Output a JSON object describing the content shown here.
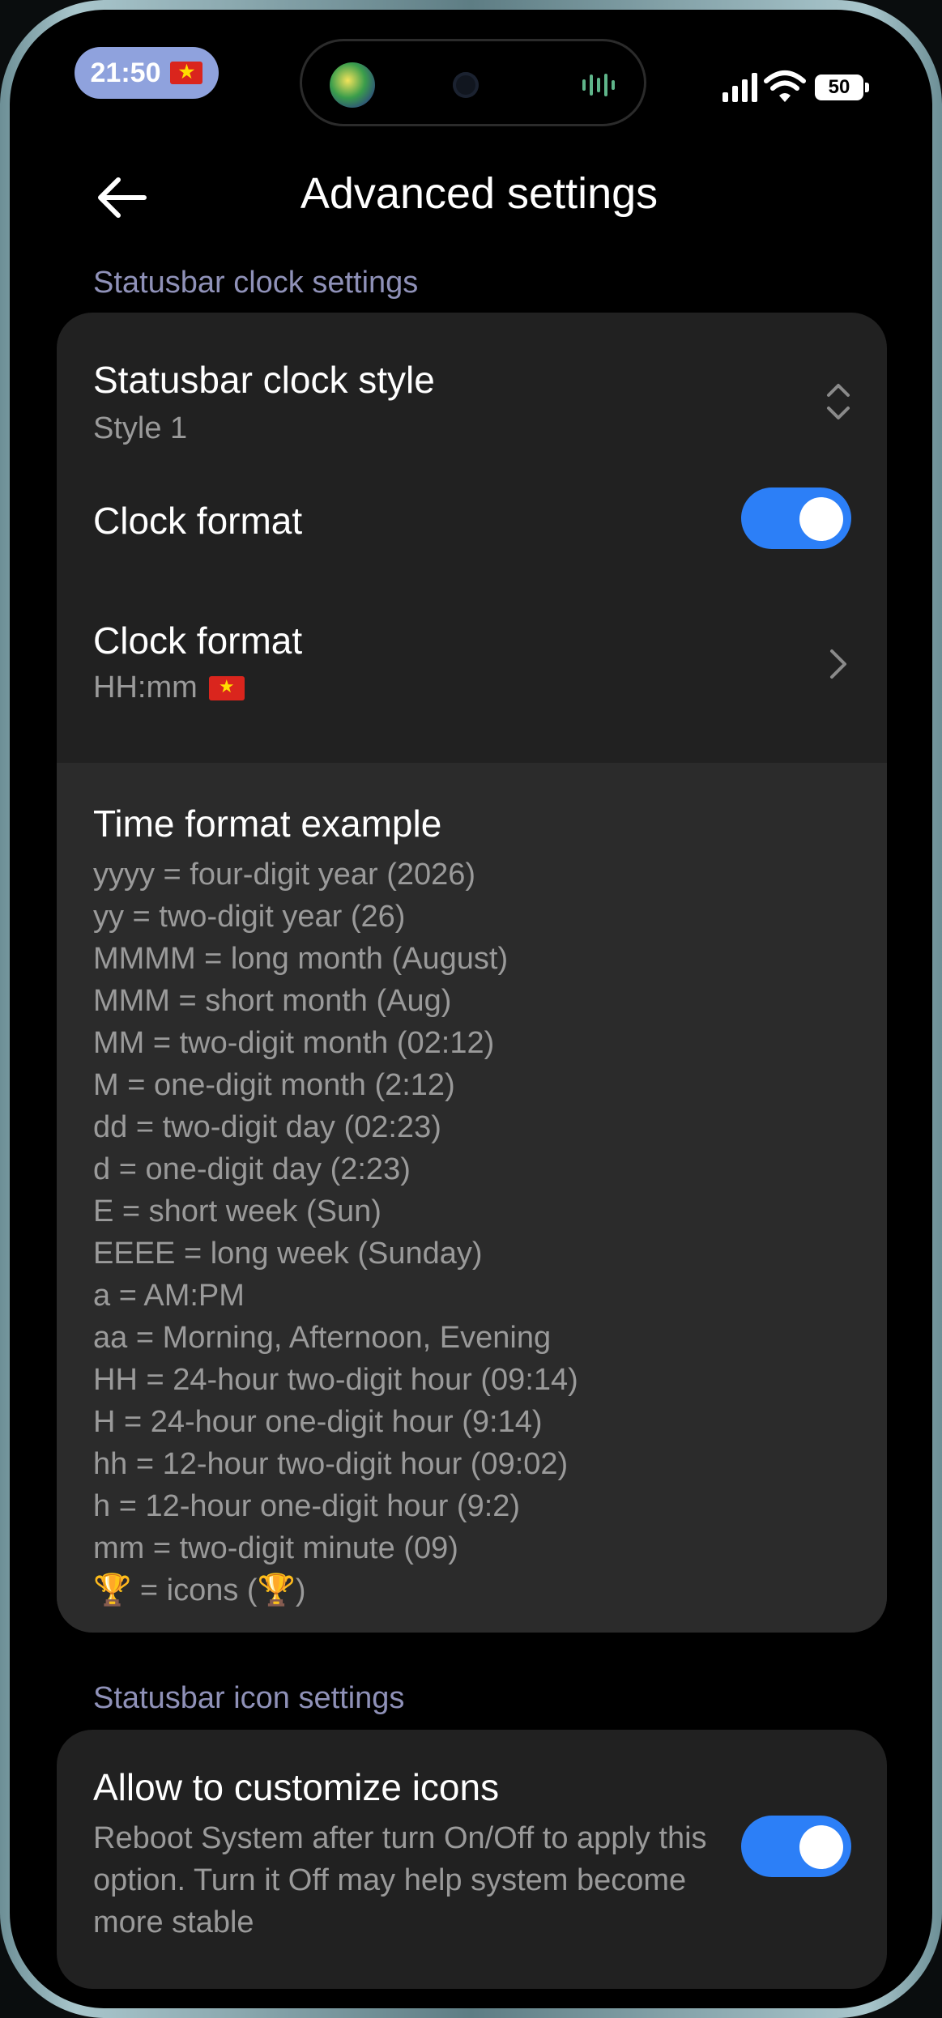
{
  "status_bar": {
    "time": "21:50",
    "battery": "50",
    "icons": [
      "vietnam-flag-icon",
      "signal-icon",
      "wifi-icon",
      "battery-icon"
    ]
  },
  "header": {
    "back_icon": "arrow-left-icon",
    "title": "Advanced settings"
  },
  "clock_section": {
    "label": "Statusbar clock settings",
    "style_item": {
      "title": "Statusbar clock style",
      "value": "Style 1",
      "icon": "unfold-chevron-icon"
    },
    "format_toggle": {
      "title": "Clock format",
      "enabled": true
    },
    "format_item": {
      "title": "Clock format",
      "value": "HH:mm",
      "icon": "chevron-right-icon"
    },
    "example": {
      "title": "Time format example",
      "lines": [
        "yyyy = four-digit year (2026)",
        "yy = two-digit year (26)",
        "MMMM = long month (August)",
        "MMM = short month (Aug)",
        "MM = two-digit month (02:12)",
        "M = one-digit month (2:12)",
        "dd = two-digit day (02:23)",
        "d = one-digit day (2:23)",
        "E = short week (Sun)",
        "EEEE = long week (Sunday)",
        "a = AM:PM",
        "aa = Morning, Afternoon, Evening",
        "HH = 24-hour two-digit hour (09:14)",
        "H = 24-hour one-digit hour (9:14)",
        "hh = 12-hour two-digit hour (09:02)",
        "h = 12-hour one-digit hour (9:2)",
        "mm = two-digit minute (09)",
        "🏆 = icons (🏆)"
      ]
    }
  },
  "icon_section": {
    "label": "Statusbar icon settings",
    "customize_item": {
      "title": "Allow to customize icons",
      "description": "Reboot System after turn On/Off to apply this option. Turn it Off may help system become more stable",
      "enabled": true
    }
  },
  "colors": {
    "accent": "#2c7ff7",
    "card": "#212121",
    "section_label": "#8f91b8",
    "status_pill": "#8fa2dd"
  }
}
